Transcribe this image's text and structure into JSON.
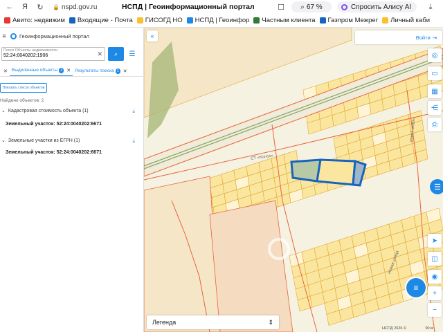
{
  "browser": {
    "url": "nspd.gov.ru",
    "page_title": "НСПД | Геоинформационный портал",
    "zoom": "67 %",
    "alice_label": "Спросить Алису AI",
    "bookmarks": [
      {
        "label": "Авито: недвижим",
        "color": "#e53935"
      },
      {
        "label": "Входящие - Почта",
        "color": "#1565c0"
      },
      {
        "label": "ГИСОГД НО",
        "color": "#fbc02d"
      },
      {
        "label": "НСПД | Геоинфор",
        "color": "#1e88e5"
      },
      {
        "label": "Частным клиента",
        "color": "#2e7d32"
      },
      {
        "label": "Газпром Межрег",
        "color": "#1565c0"
      },
      {
        "label": "Личный каби",
        "color": "#fbc02d"
      }
    ]
  },
  "panel": {
    "title": "Геоинформационный портал",
    "search": {
      "placeholder": "Поиск Объекты недвижимости",
      "value": "52:24:0040202:1906"
    },
    "tabs": [
      {
        "label": "Выделенные объекты",
        "badge": "3"
      },
      {
        "label": "Результаты поиска",
        "badge": "1"
      }
    ],
    "show_list_button": "Показать список объектов",
    "found_text": "Найдено объектов: 2",
    "groups": [
      {
        "header": "Кадастровая стоимость объекта (1)",
        "item": "Земельный участок: 52:24:0040202:6671"
      },
      {
        "header": "Земельные участки из ЕГРН (1)",
        "item": "Земельный участок: 52:24:0040202:6671"
      }
    ]
  },
  "map": {
    "login_label": "Войти",
    "legend_label": "Легенда",
    "scale_text": "НСПД 2026 ©",
    "scale_unit": "90 м",
    "area_label": "СТ «Колос»",
    "street_1": "Новая улица",
    "street_2": "Новая улица",
    "colors": {
      "parcel_fill": "#fbe6a0",
      "parcel_stroke": "#e0a830",
      "boundary": "#e8643a",
      "selected": "#1565c0",
      "accent": "#1e88e5"
    }
  }
}
